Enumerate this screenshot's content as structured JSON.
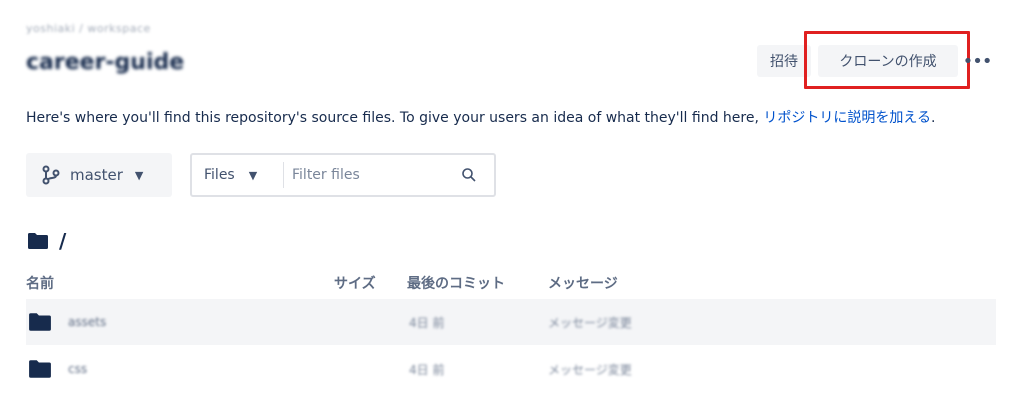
{
  "header": {
    "breadcrumb": "yoshiaki / workspace",
    "repo_name": "career-guide",
    "invite_label": "招待",
    "clone_label": "クローンの作成",
    "more_label": "•••"
  },
  "description": {
    "text": "Here's where you'll find this repository's source files. To give your users an idea of what they'll find here, ",
    "link": "リポジトリに説明を加える",
    "suffix": "."
  },
  "toolbar": {
    "branch": "master",
    "files_label": "Files",
    "filter_placeholder": "Filter files"
  },
  "path": "/",
  "table": {
    "headers": {
      "name": "名前",
      "size": "サイズ",
      "last_commit": "最後のコミット",
      "message": "メッセージ"
    },
    "rows": [
      {
        "name": "assets",
        "commit": "4日 前",
        "message": "メッセージ変更"
      },
      {
        "name": "css",
        "commit": "4日 前",
        "message": "メッセージ変更"
      }
    ]
  },
  "colors": {
    "link": "#0052cc",
    "highlight": "#e02020",
    "row_bg": "#f4f5f7"
  }
}
